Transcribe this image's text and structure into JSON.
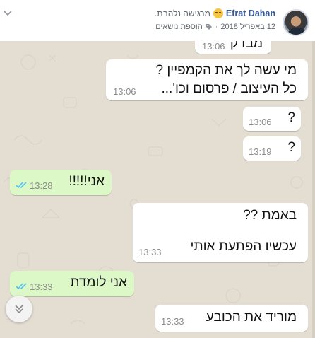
{
  "post": {
    "author": "Efrat Dahan",
    "feeling": "מרגישה נלהבת.",
    "date": "12 באפריל 2018",
    "separator": "·",
    "add_topics": "הוספת נושאים"
  },
  "messages": [
    {
      "id": "m0",
      "direction": "incoming",
      "lines": [
        "מבדק"
      ],
      "time": "13:06"
    },
    {
      "id": "m1",
      "direction": "incoming",
      "lines": [
        "מי עשה לך את הקמפיין ?",
        "כל העיצוב / פרסום וכו'..."
      ],
      "time": "13:06"
    },
    {
      "id": "m2",
      "direction": "incoming",
      "lines": [
        "?"
      ],
      "time": "13:06"
    },
    {
      "id": "m3",
      "direction": "incoming",
      "lines": [
        "?"
      ],
      "time": "13:19"
    },
    {
      "id": "m4",
      "direction": "outgoing",
      "lines": [
        "אני!!!!!"
      ],
      "time": "13:28",
      "read": true
    },
    {
      "id": "m5",
      "direction": "incoming",
      "lines": [
        "באמת ??",
        "עכשיו הפתעת אותי"
      ],
      "time": "13:33"
    },
    {
      "id": "m6",
      "direction": "outgoing",
      "lines": [
        "אני לומדת"
      ],
      "time": "13:33",
      "read": true
    },
    {
      "id": "m7",
      "direction": "incoming",
      "lines": [
        "מוריד את הכובע"
      ],
      "time": "13:33"
    }
  ],
  "colors": {
    "incoming_bubble": "#ffffff",
    "outgoing_bubble": "#dcf8c6",
    "read_ticks": "#4fc3f7",
    "chat_background": "#e4ddd2",
    "author_link": "#365899"
  },
  "icons": {
    "dropdown": "chevron-down-icon",
    "topics": "tag-icon",
    "scroll_down": "double-chevron-down-icon",
    "read_receipt": "double-check-icon"
  }
}
